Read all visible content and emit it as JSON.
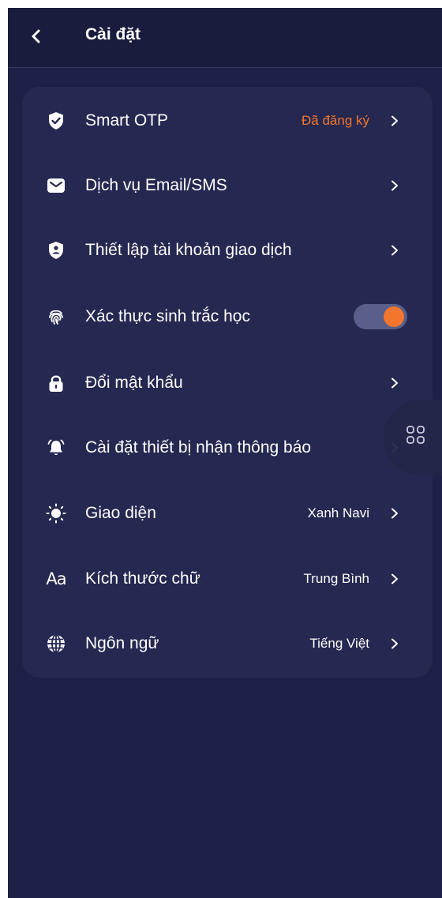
{
  "header": {
    "title": "Cài đặt"
  },
  "settings": {
    "items": [
      {
        "icon": "shield-check-icon",
        "label": "Smart OTP",
        "value": "Đã đăng ký"
      },
      {
        "icon": "mail-icon",
        "label": "Dịch vụ Email/SMS",
        "value": ""
      },
      {
        "icon": "shield-account-icon",
        "label": "Thiết lập tài khoản giao dịch",
        "value": ""
      },
      {
        "icon": "fingerprint-icon",
        "label": "Xác thực sinh trắc học",
        "toggle_on": true
      },
      {
        "icon": "lock-icon",
        "label": "Đổi mật khẩu",
        "value": ""
      },
      {
        "icon": "bell-icon",
        "label": "Cài đặt thiết bị nhận thông báo",
        "value": ""
      },
      {
        "icon": "sun-icon",
        "label": "Giao diện",
        "value": "Xanh Navi"
      },
      {
        "icon": "font-size-icon",
        "label": "Kích thước chữ",
        "value": "Trung Bình",
        "icon_text": "Aa"
      },
      {
        "icon": "globe-icon",
        "label": "Ngôn ngữ",
        "value": "Tiếng Việt"
      }
    ]
  },
  "floating_menu": {
    "icon": "apps-grid-icon"
  },
  "colors": {
    "background": "#1e2047",
    "card": "#252850",
    "accent": "#f2762e",
    "toggle_track": "#5a5e8a"
  }
}
